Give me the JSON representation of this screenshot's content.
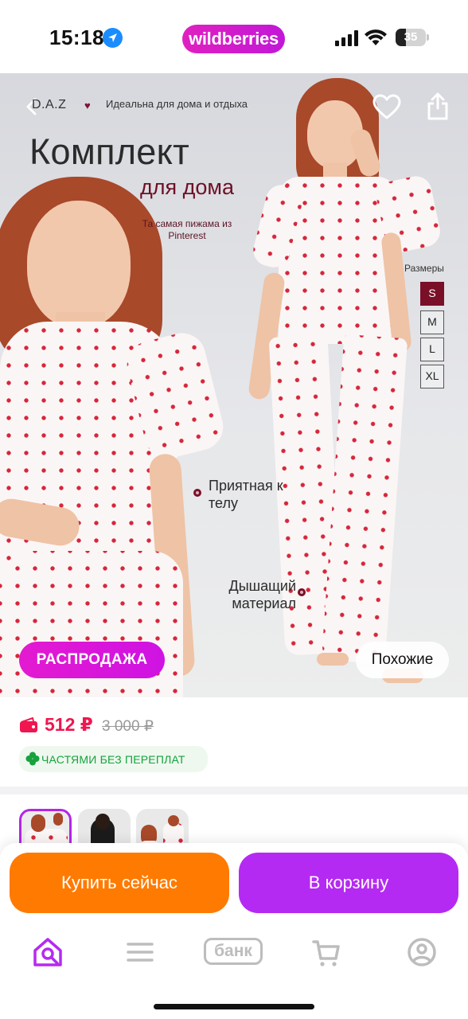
{
  "status_bar": {
    "time": "15:18",
    "app_logo": "wildberries",
    "battery": "35",
    "battery_level": 0.35,
    "icons": [
      "location-arrow-icon",
      "signal-icon",
      "wifi-icon",
      "battery-icon"
    ]
  },
  "hero": {
    "brand": "D.A.Z",
    "brand_tagline": "Идеальна для дома и отдыха",
    "title": "Комплект",
    "subtitle": "для дома",
    "tagline": "Та самая пижама из Pinterest",
    "sizes_label": "Размеры",
    "sizes": [
      "S",
      "M",
      "L",
      "XL"
    ],
    "selected_size": "S",
    "features": [
      "Приятная к телу",
      "Дышащий материал"
    ],
    "sale_badge": "РАСПРОДАЖА",
    "similar_button": "Похожие",
    "icons": [
      "back-icon",
      "heart-icon",
      "share-icon"
    ]
  },
  "price": {
    "current": "512 ₽",
    "old": "3 000 ₽",
    "installments": "ЧАСТЯМИ БЕЗ ПЕРЕПЛАТ",
    "icons": [
      "wallet-icon",
      "clover-icon"
    ]
  },
  "actions": {
    "buy_now": "Купить сейчас",
    "add_to_cart": "В корзину"
  },
  "tab_bar": {
    "bank": "банк",
    "icons": [
      "home-search-icon",
      "menu-icon",
      "bank-icon",
      "cart-icon",
      "profile-icon"
    ]
  },
  "colors": {
    "brand_magenta": "#cf13e3",
    "price_red": "#f0164f",
    "buy_orange": "#ff7a00",
    "cart_purple": "#b52af2",
    "size_active": "#7a0f28",
    "installment_green": "#16a23c"
  }
}
